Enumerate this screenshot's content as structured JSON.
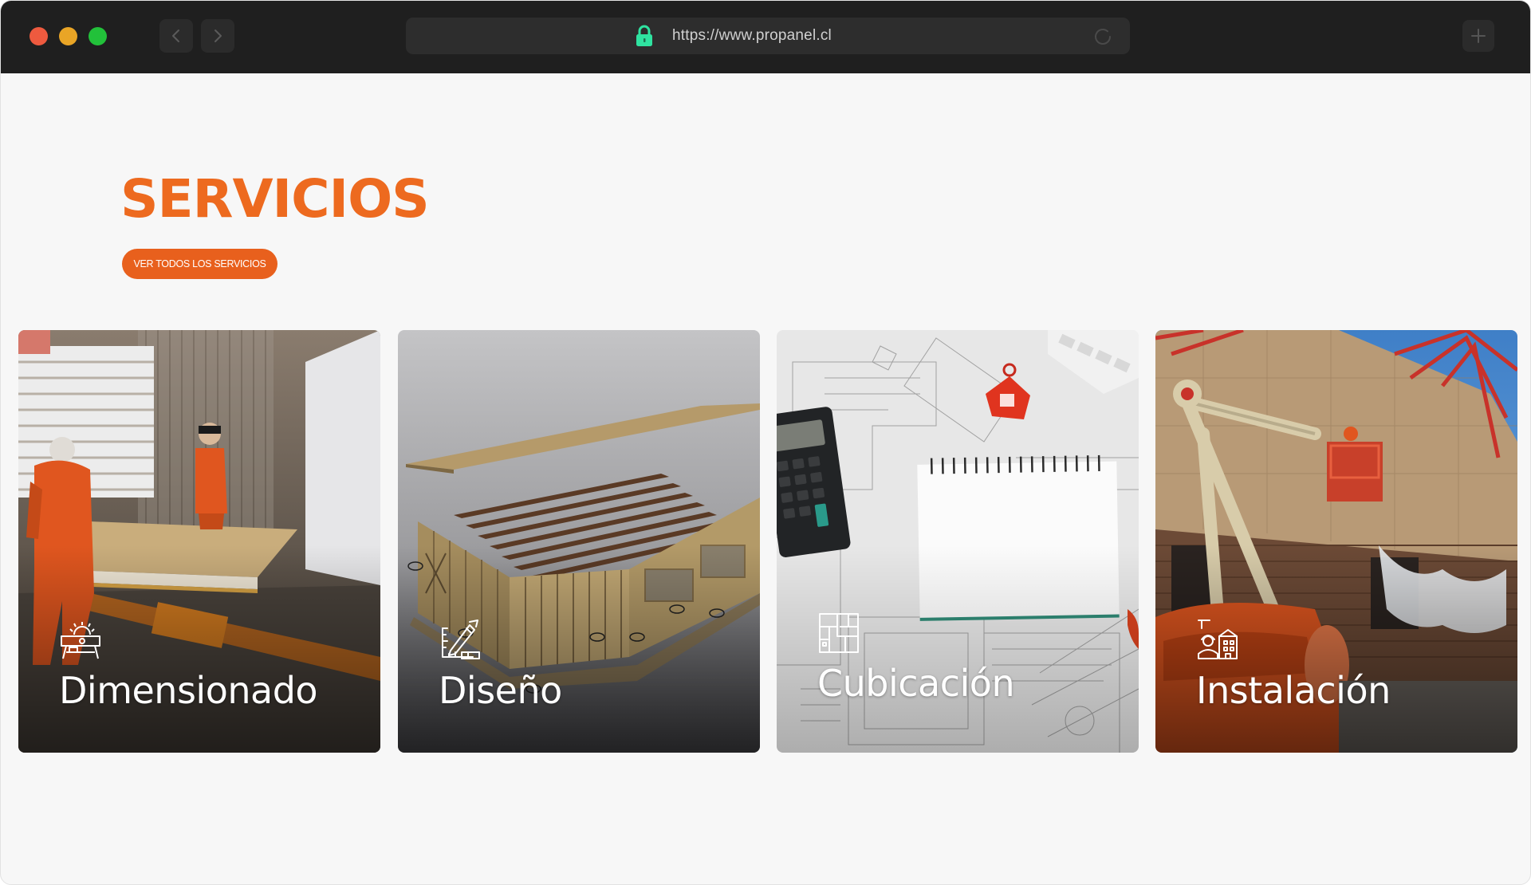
{
  "browser": {
    "url": "https://www.propanel.cl"
  },
  "page": {
    "title": "SERVICIOS",
    "cta_label": "VER TODOS LOS SERVICIOS"
  },
  "services": [
    {
      "label": "Dimensionado",
      "icon": "saw-table-icon"
    },
    {
      "label": "Diseño",
      "icon": "design-ruler-icon"
    },
    {
      "label": "Cubicación",
      "icon": "floor-plan-icon"
    },
    {
      "label": "Instalación",
      "icon": "worker-building-icon"
    }
  ],
  "colors": {
    "accent": "#ed6a1f",
    "titlebar": "#1f1f1f",
    "background": "#f7f7f7"
  }
}
